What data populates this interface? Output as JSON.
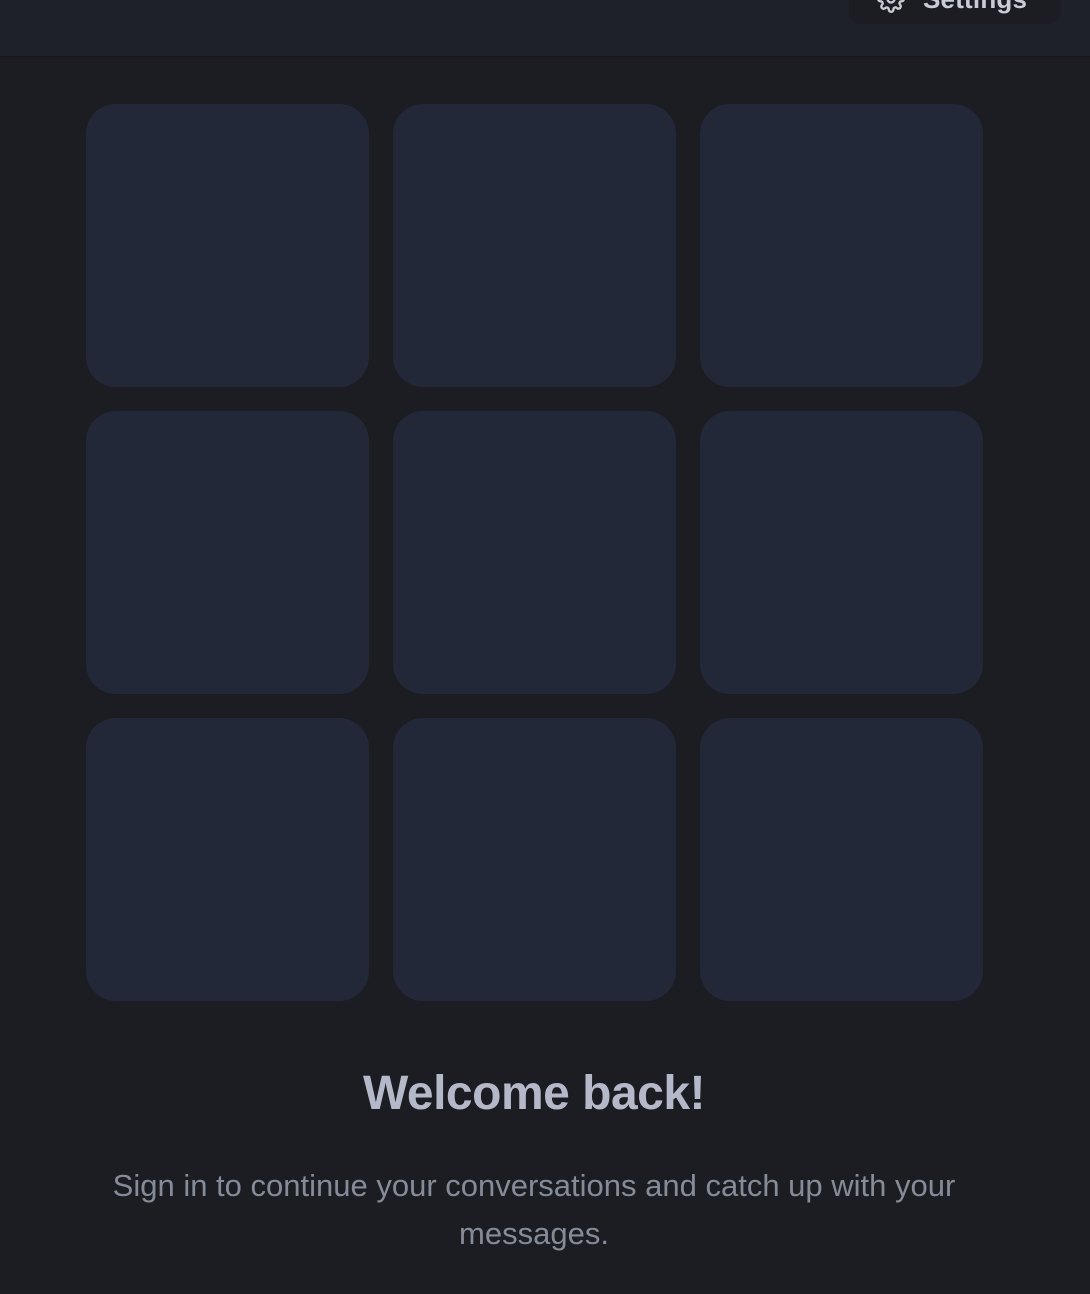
{
  "header": {
    "settings_label": "Settings",
    "settings_icon": "gear-icon"
  },
  "grid": {
    "tiles": [
      "",
      "",
      "",
      "",
      "",
      "",
      "",
      "",
      ""
    ]
  },
  "welcome": {
    "title": "Welcome back!",
    "subtitle": "Sign in to continue your conversations and catch up with your messages."
  },
  "colors": {
    "background": "#1b1d22",
    "header": "#1e2129",
    "tile": "#232839",
    "title": "#b4b8c8",
    "subtitle": "#868b98"
  }
}
